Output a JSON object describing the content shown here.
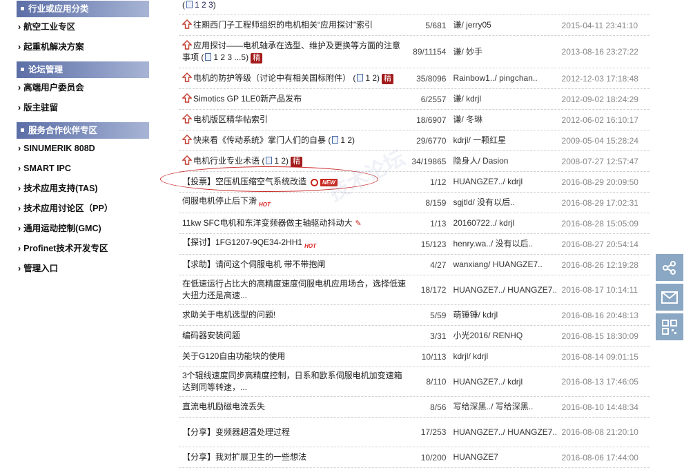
{
  "sidebar": {
    "sections": [
      {
        "title": "行业或应用分类",
        "items": [
          "航空工业专区",
          "起重机解决方案"
        ]
      },
      {
        "title": "论坛管理",
        "items": [
          "高端用户委员会",
          "版主驻留"
        ]
      },
      {
        "title": "服务合作伙伴专区",
        "items": [
          "SINUMERIK 808D",
          "SMART IPC",
          "技术应用支持(TAS)",
          "技术应用讨论区（PP）",
          "通用运动控制(GMC)",
          "Profinet技术开发专区",
          "管理入口"
        ]
      }
    ]
  },
  "top_fragment": {
    "pages": "1 2 3"
  },
  "threads": [
    {
      "title": "往期西门子工程师组织的电机相关“应用探讨”索引",
      "pinned": true,
      "count": "5/681",
      "author": "谦/ jerry05",
      "date": "2015-04-11 23:41:10"
    },
    {
      "title": "应用探讨——电机轴承在选型、维护及更换等方面的注意事项",
      "pinned": true,
      "pages": "1 2 3 ...5",
      "jing": "精",
      "count": "89/11154",
      "author": "谦/ 妙手",
      "date": "2013-08-16 23:27:22"
    },
    {
      "title": "电机的防护等级（讨论中有相关国标附件）",
      "pinned": true,
      "pages": "1 2",
      "jing": "精",
      "count": "35/8096",
      "author": "Rainbow1../ pingchan..",
      "date": "2012-12-03 17:18:48"
    },
    {
      "title": "Simotics GP 1LE0新产品发布",
      "pinned": true,
      "count": "6/2557",
      "author": "谦/ kdrjl",
      "date": "2012-09-02 18:24:29"
    },
    {
      "title": "电机版区精华帖索引",
      "pinned": true,
      "count": "18/6907",
      "author": "谦/ 冬琳",
      "date": "2012-06-02 16:10:17"
    },
    {
      "title": "快来看《传动系统》掌门人们的自暴",
      "pinned": true,
      "pages": "1 2",
      "count": "29/6770",
      "author": "kdrjl/ 一颗红星",
      "date": "2009-05-04 15:28:24"
    },
    {
      "title": "电机行业专业术语",
      "pinned": true,
      "pages": "1 2",
      "jing": "精",
      "count": "34/19865",
      "author": "隐身人/ Dasion",
      "date": "2008-07-27 12:57:47"
    },
    {
      "title": "【投票】空压机压缩空气系统改造",
      "vote": true,
      "new": "NEW",
      "count": "1/12",
      "author": "HUANGZE7../ kdrjl",
      "date": "2016-08-29 20:09:50"
    },
    {
      "title": "伺服电机停止后下滑",
      "hot": "HOT",
      "count": "8/159",
      "author": "sgjtld/ 没有以后..",
      "date": "2016-08-29 17:02:31"
    },
    {
      "title": "11kw SFC电机和东洋变频器做主轴驱动抖动大",
      "pencil": true,
      "count": "1/13",
      "author": "20160722../ kdrjl",
      "date": "2016-08-28 15:05:09"
    },
    {
      "title": "【探讨】1FG1207-9QE34-2HH1",
      "hot": "HOT",
      "count": "15/123",
      "author": "henry.wa../ 没有以后..",
      "date": "2016-08-27 20:54:14"
    },
    {
      "title": "【求助】请问这个伺服电机 带不带抱闸",
      "count": "4/27",
      "author": "wanxiang/ HUANGZE7..",
      "date": "2016-08-26 12:19:28"
    },
    {
      "title": "在低速运行占比大的高精度速度伺服电机应用场合，选择低速大扭力还是高速...",
      "count": "18/172",
      "author": "HUANGZE7../ HUANGZE7..",
      "date": "2016-08-17 10:14:11"
    },
    {
      "title": "求助关于电机选型的问题!",
      "count": "5/59",
      "author": "萌锤锤/ kdrjl",
      "date": "2016-08-16 20:48:13"
    },
    {
      "title": "编码器安装问题",
      "count": "3/31",
      "author": "小光2016/ RENHQ",
      "date": "2016-08-15 18:30:09"
    },
    {
      "title": "关于G120自由功能块的使用",
      "count": "10/113",
      "author": "kdrjl/ kdrjl",
      "date": "2016-08-14 09:01:15"
    },
    {
      "title": "3个辊线速度同步高精度控制，日系和欧系伺服电机加变速箱达到同等转速，...",
      "count": "8/110",
      "author": "HUANGZE7../ kdrjl",
      "date": "2016-08-13 17:46:05"
    },
    {
      "title": "直流电机励磁电流丢失",
      "count": "8/56",
      "author": "写给深黑../ 写给深黑..",
      "date": "2016-08-10 14:48:34"
    },
    {
      "title": "【分享】变频器超温处理过程",
      "count": "17/253",
      "author": "HUANGZE7../ HUANGZE7..",
      "date": "2016-08-08 21:20:10"
    },
    {
      "title": "【分享】我对扩展卫生的一些想法",
      "count": "10/200",
      "author": "HUANGZE7",
      "date": "2016-08-06 17:44:00"
    }
  ],
  "watermark": "技术论坛",
  "floatbar": {
    "buttons": [
      "share-icon",
      "mail-icon",
      "qrcode-icon"
    ]
  },
  "colors": {
    "sidebar_head": "#5b6ea6",
    "jing_badge": "#a31b1b",
    "float_btn": "#8aa7c3",
    "date_text": "#888888"
  }
}
